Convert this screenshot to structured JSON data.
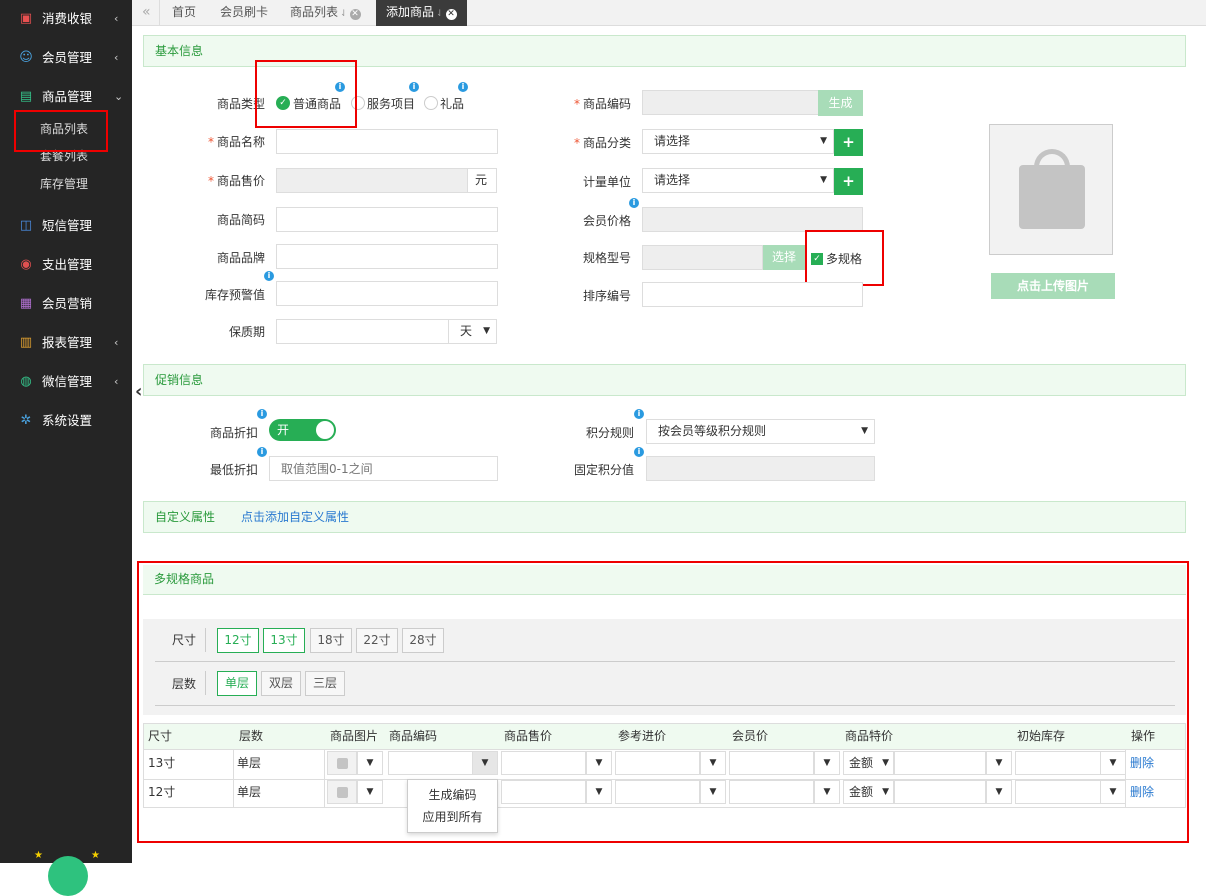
{
  "sidebar": {
    "items": [
      {
        "label": "消费收银",
        "icon": "cashier-icon",
        "glyph": "▣",
        "color": "#e85050",
        "arrow": "‹"
      },
      {
        "label": "会员管理",
        "icon": "members-icon",
        "glyph": "☺",
        "color": "#4aa3e0",
        "arrow": "‹"
      },
      {
        "label": "商品管理",
        "icon": "goods-icon",
        "glyph": "▤",
        "color": "#35c28a",
        "arrow": "⌄"
      },
      {
        "label": "短信管理",
        "icon": "sms-icon",
        "glyph": "◫",
        "color": "#4a8be0",
        "arrow": ""
      },
      {
        "label": "支出管理",
        "icon": "expense-icon",
        "glyph": "◉",
        "color": "#e05050",
        "arrow": ""
      },
      {
        "label": "会员营销",
        "icon": "gift-icon",
        "glyph": "▦",
        "color": "#b070d0",
        "arrow": ""
      },
      {
        "label": "报表管理",
        "icon": "report-icon",
        "glyph": "▥",
        "color": "#e0a030",
        "arrow": "‹"
      },
      {
        "label": "微信管理",
        "icon": "wechat-icon",
        "glyph": "◍",
        "color": "#35c28a",
        "arrow": "‹"
      },
      {
        "label": "系统设置",
        "icon": "settings-icon",
        "glyph": "✲",
        "color": "#4aa3e0",
        "arrow": ""
      }
    ],
    "sub_items": [
      "商品列表",
      "套餐列表",
      "库存管理"
    ]
  },
  "tabs": {
    "back": "«",
    "items": [
      {
        "label": "首页"
      },
      {
        "label": "会员刷卡"
      },
      {
        "label": "商品列表",
        "pin": "⇃",
        "close": "✕"
      },
      {
        "label": "添加商品",
        "pin": "⇃",
        "close": "✕"
      }
    ]
  },
  "basic": {
    "section_title": "基本信息",
    "type_label": "商品类型",
    "type_options": [
      "普通商品",
      "服务项目",
      "礼品"
    ],
    "name_label": "商品名称",
    "price_label": "商品售价",
    "price_unit": "元",
    "short_code_label": "商品简码",
    "brand_label": "商品品牌",
    "stock_warn_label": "库存预警值",
    "shelf_label": "保质期",
    "shelf_unit": "天",
    "code_label": "商品编码",
    "generate_btn": "生成",
    "category_label": "商品分类",
    "category_value": "请选择",
    "unit_label": "计量单位",
    "unit_value": "请选择",
    "member_price_label": "会员价格",
    "spec_label": "规格型号",
    "spec_select_btn": "选择",
    "multi_spec_label": "多规格",
    "sort_label": "排序编号",
    "add_btn": "+",
    "upload_btn": "点击上传图片"
  },
  "promo": {
    "section_title": "促销信息",
    "discount_label": "商品折扣",
    "discount_toggle": "开",
    "min_discount_label": "最低折扣",
    "min_discount_placeholder": "取值范围0-1之间",
    "points_rule_label": "积分规则",
    "points_rule_value": "按会员等级积分规则",
    "fixed_points_label": "固定积分值"
  },
  "custom": {
    "section_title": "自定义属性",
    "add_link": "点击添加自定义属性"
  },
  "multi": {
    "section_title": "多规格商品",
    "size_label": "尺寸",
    "sizes": [
      {
        "label": "12寸",
        "on": true
      },
      {
        "label": "13寸",
        "on": true
      },
      {
        "label": "18寸",
        "on": false
      },
      {
        "label": "22寸",
        "on": false
      },
      {
        "label": "28寸",
        "on": false
      }
    ],
    "layer_label": "层数",
    "layers": [
      {
        "label": "单层",
        "on": true
      },
      {
        "label": "双层",
        "on": false
      },
      {
        "label": "三层",
        "on": false
      }
    ],
    "table": {
      "headers": [
        "尺寸",
        "层数",
        "商品图片",
        "商品编码",
        "商品售价",
        "参考进价",
        "会员价",
        "商品特价",
        "初始库存",
        "操作"
      ],
      "rows": [
        {
          "size": "13寸",
          "layer": "单层",
          "special_type": "金额",
          "action": "删除"
        },
        {
          "size": "12寸",
          "layer": "单层",
          "special_type": "金额",
          "action": "删除"
        }
      ]
    },
    "dropdown_menu": [
      "生成编码",
      "应用到所有"
    ]
  },
  "collapse_arrow": "‹"
}
